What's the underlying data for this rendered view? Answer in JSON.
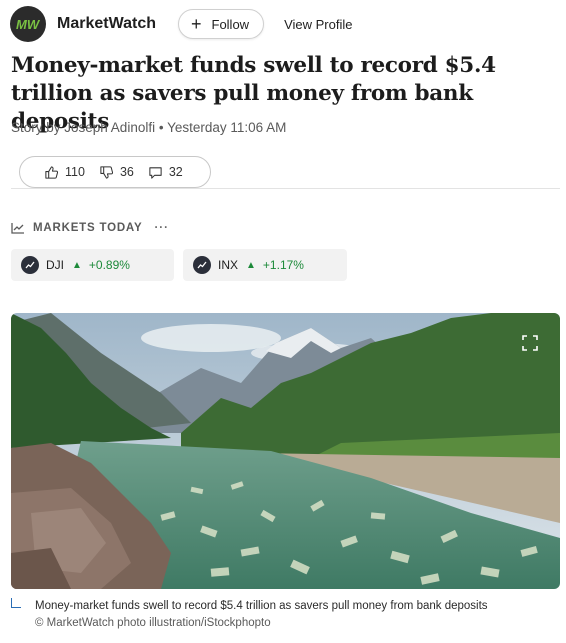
{
  "header": {
    "logo_text": "MW",
    "publisher": "MarketWatch",
    "follow_label": "Follow",
    "view_profile_label": "View Profile"
  },
  "article": {
    "headline": "Money-market funds swell to record $5.4 trillion as savers pull money from bank deposits",
    "byline": "Story by Joseph Adinolfi • Yesterday 11:06 AM"
  },
  "reactions": {
    "likes": "110",
    "dislikes": "36",
    "comments": "32"
  },
  "markets": {
    "heading": "MARKETS TODAY",
    "more_label": "···",
    "tickers": [
      {
        "symbol": "DJI",
        "change": "+0.89%",
        "direction": "up"
      },
      {
        "symbol": "INX",
        "change": "+1.17%",
        "direction": "up"
      }
    ],
    "up_color": "#1d8a3a"
  },
  "image": {
    "caption": "Money-market funds swell to record $5.4 trillion as savers pull money from bank deposits",
    "credit": "© MarketWatch photo illustration/iStockphopto"
  }
}
